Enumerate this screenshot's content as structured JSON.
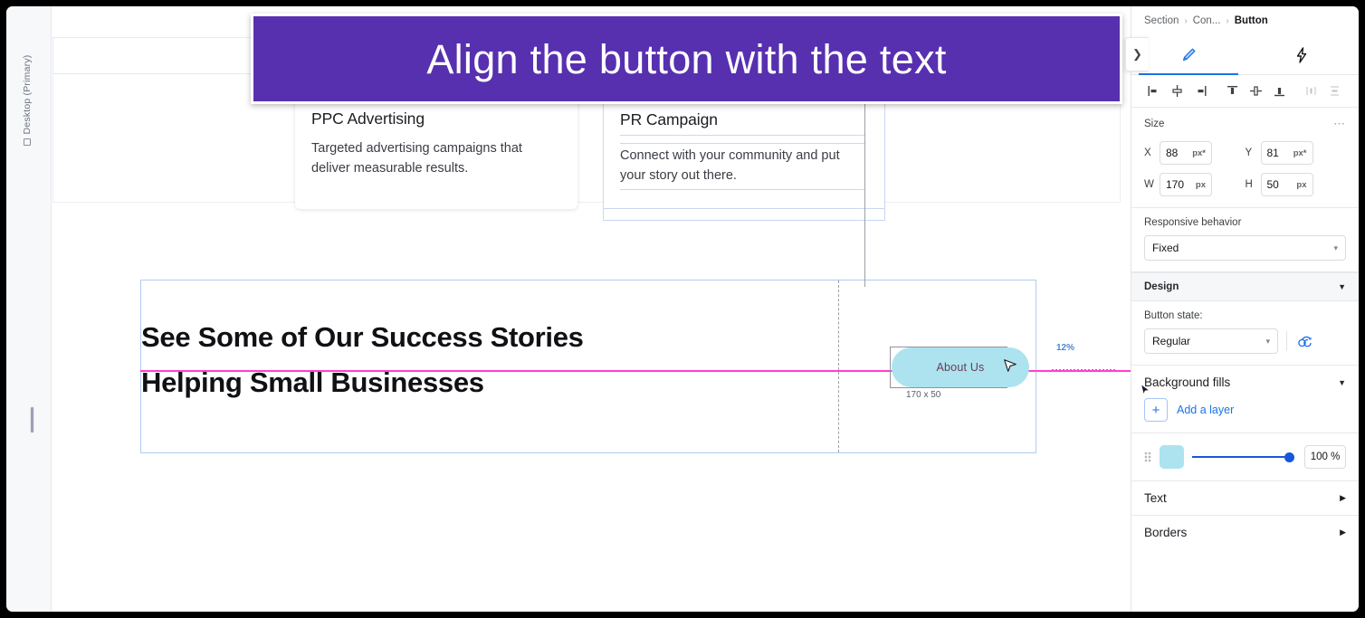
{
  "banner": {
    "text": "Align the button with the text"
  },
  "left_rail": {
    "device_label": "Desktop (Primary)",
    "monitor_icon": "monitor-icon"
  },
  "canvas": {
    "cards": [
      {
        "title": "PPC Advertising",
        "body": "Targeted advertising campaigns that deliver measurable results."
      },
      {
        "title": "PR Campaign",
        "body": "Connect with your community and put your story out there."
      }
    ],
    "hero": {
      "line1": "See Some of Our Success Stories",
      "line2": "Helping Small Businesses"
    },
    "selected_button": {
      "label": "About Us",
      "zoom_badge": "12%",
      "dimensions": "170 x 50",
      "fill_color": "#ace3ef",
      "guide_color": "#ff3fd2"
    }
  },
  "collapse_button": {
    "icon": "chevron-right-icon",
    "glyph": "❯"
  },
  "panel": {
    "breadcrumb": {
      "items": [
        "Section",
        "Con...",
        "Button"
      ],
      "separator": "›"
    },
    "tabs": [
      {
        "name": "design-tab",
        "icon": "paintbrush-icon",
        "active": true
      },
      {
        "name": "interactions-tab",
        "icon": "lightning-bolt-icon",
        "active": false
      }
    ],
    "align_tools": [
      "align-left-icon",
      "align-center-horizontal-icon",
      "align-right-icon",
      "align-top-icon",
      "align-middle-vertical-icon",
      "align-bottom-icon",
      "distribute-horizontal-icon",
      "distribute-vertical-icon"
    ],
    "size": {
      "heading": "Size",
      "overflow_glyph": "⋯",
      "fields": [
        {
          "label": "X",
          "value": "88",
          "unit": "px*"
        },
        {
          "label": "Y",
          "value": "81",
          "unit": "px*"
        },
        {
          "label": "W",
          "value": "170",
          "unit": "px"
        },
        {
          "label": "H",
          "value": "50",
          "unit": "px"
        }
      ]
    },
    "responsive": {
      "label": "Responsive behavior",
      "value": "Fixed"
    },
    "design": {
      "heading": "Design",
      "caret": "▼",
      "button_state_label": "Button state:",
      "button_state_value": "Regular",
      "reset_icon": "reset-state-icon"
    },
    "background_fills": {
      "heading": "Background fills",
      "caret": "▼",
      "add_layer_label": "Add a layer",
      "add_layer_glyph": "+",
      "layer": {
        "color": "#ace3ef",
        "opacity": "100 %",
        "grip_icon": "drag-grip-icon"
      }
    },
    "rows": [
      {
        "label": "Text",
        "caret": "▶"
      },
      {
        "label": "Borders",
        "caret": "▶"
      }
    ]
  }
}
